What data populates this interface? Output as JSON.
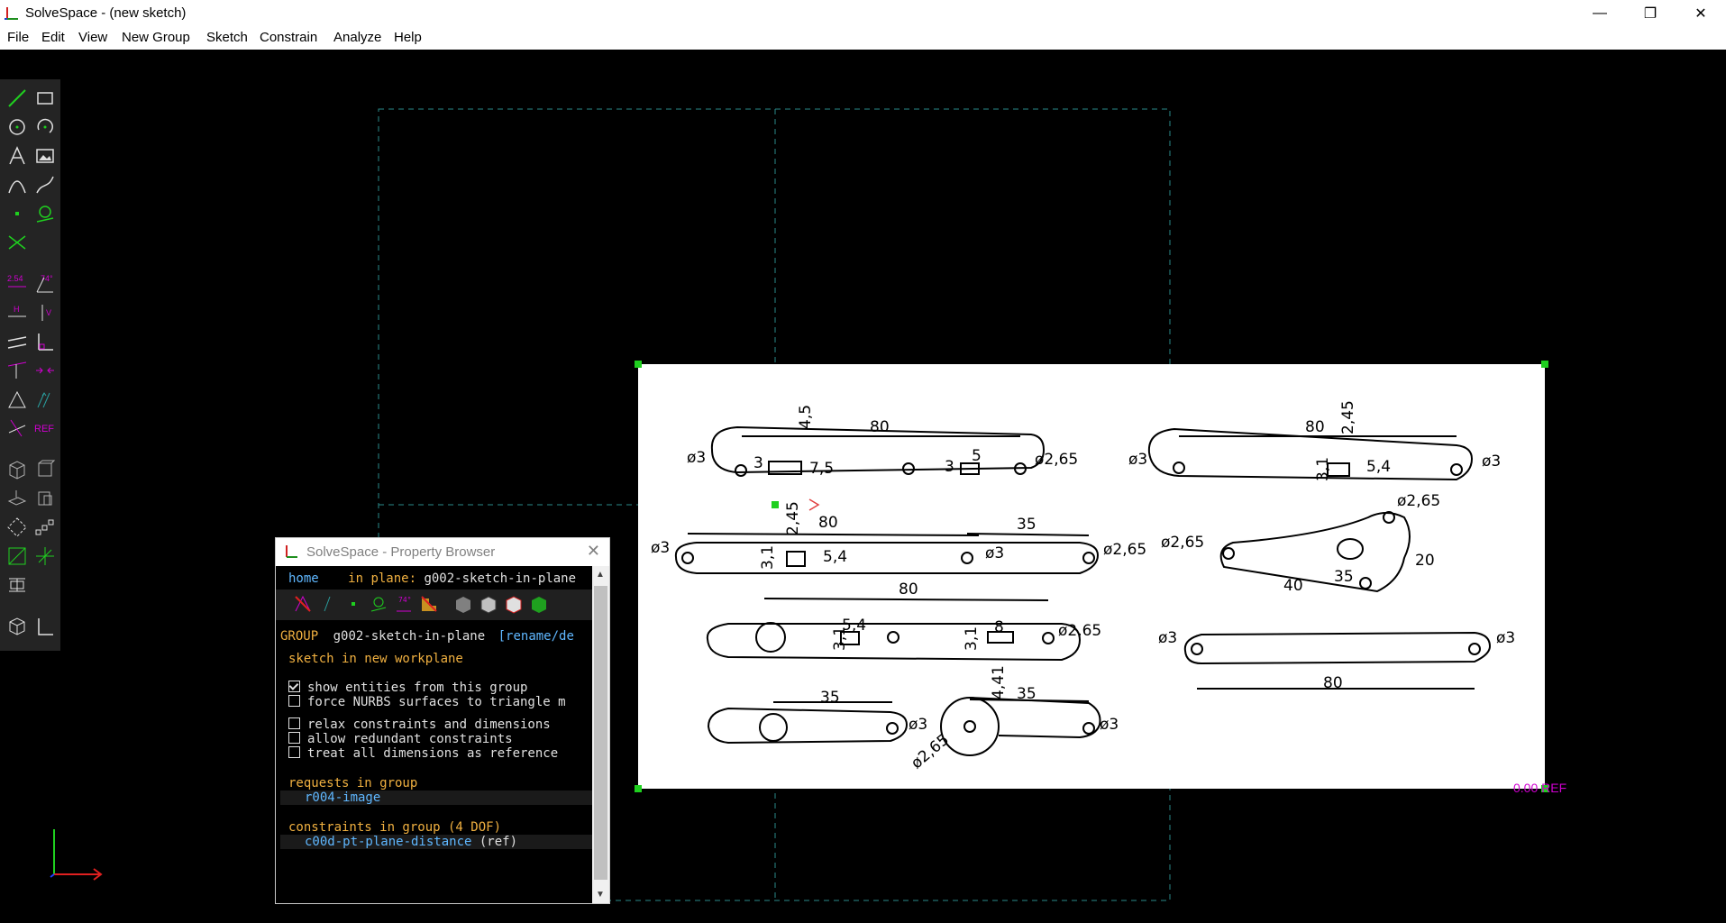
{
  "window": {
    "title": "SolveSpace - (new sketch)",
    "min": "—",
    "max": "❐",
    "close": "✕"
  },
  "menu": [
    "File",
    "Edit",
    "View",
    "New Group",
    "Sketch",
    "Constrain",
    "Analyze",
    "Help"
  ],
  "toolbar": {
    "dim_label": "2.54",
    "angle_label": "74°",
    "h_label": "H",
    "v_label": "V",
    "ref_label": "REF"
  },
  "canvas": {
    "ref_value": "0.00",
    "ref_text": "REF"
  },
  "drawing": {
    "dims": [
      "4,5",
      "80",
      "ø3",
      "3",
      "7,5",
      "5",
      "3",
      "ø2,65",
      "80",
      "2,45",
      "ø3",
      "3,1",
      "5,4",
      "ø3",
      "2,45",
      "80",
      "35",
      "ø3",
      "3,1",
      "5,4",
      "ø3",
      "ø2,65",
      "ø2,65",
      "ø2,65",
      "35",
      "20",
      "40",
      "80",
      "5,4",
      "3,1",
      "8",
      "3,1",
      "ø2,65",
      "ø3",
      "ø3",
      "80",
      "35",
      "ø3",
      "4,41",
      "35",
      "ø3",
      "ø2,65"
    ]
  },
  "property_browser": {
    "title": "SolveSpace - Property Browser",
    "home": "home",
    "in_plane_label": "in plane:",
    "in_plane_value": "g002-sketch-in-plane",
    "group_label": "GROUP",
    "group_name": "g002-sketch-in-plane",
    "group_action": "[rename/de",
    "group_desc": "sketch in new workplane",
    "options": [
      {
        "label": "show entities from this group",
        "checked": true
      },
      {
        "label": "force NURBS surfaces to triangle m",
        "checked": false
      },
      {
        "label": "relax constraints and dimensions",
        "checked": false
      },
      {
        "label": "allow redundant constraints",
        "checked": false
      },
      {
        "label": "treat all dimensions as reference",
        "checked": false
      }
    ],
    "requests_header": "requests in group",
    "requests": [
      "r004-image"
    ],
    "constraints_header": "constraints in group (4 DOF)",
    "constraints": [
      {
        "name": "c00d-pt-plane-distance",
        "suffix": "(ref)"
      }
    ]
  }
}
